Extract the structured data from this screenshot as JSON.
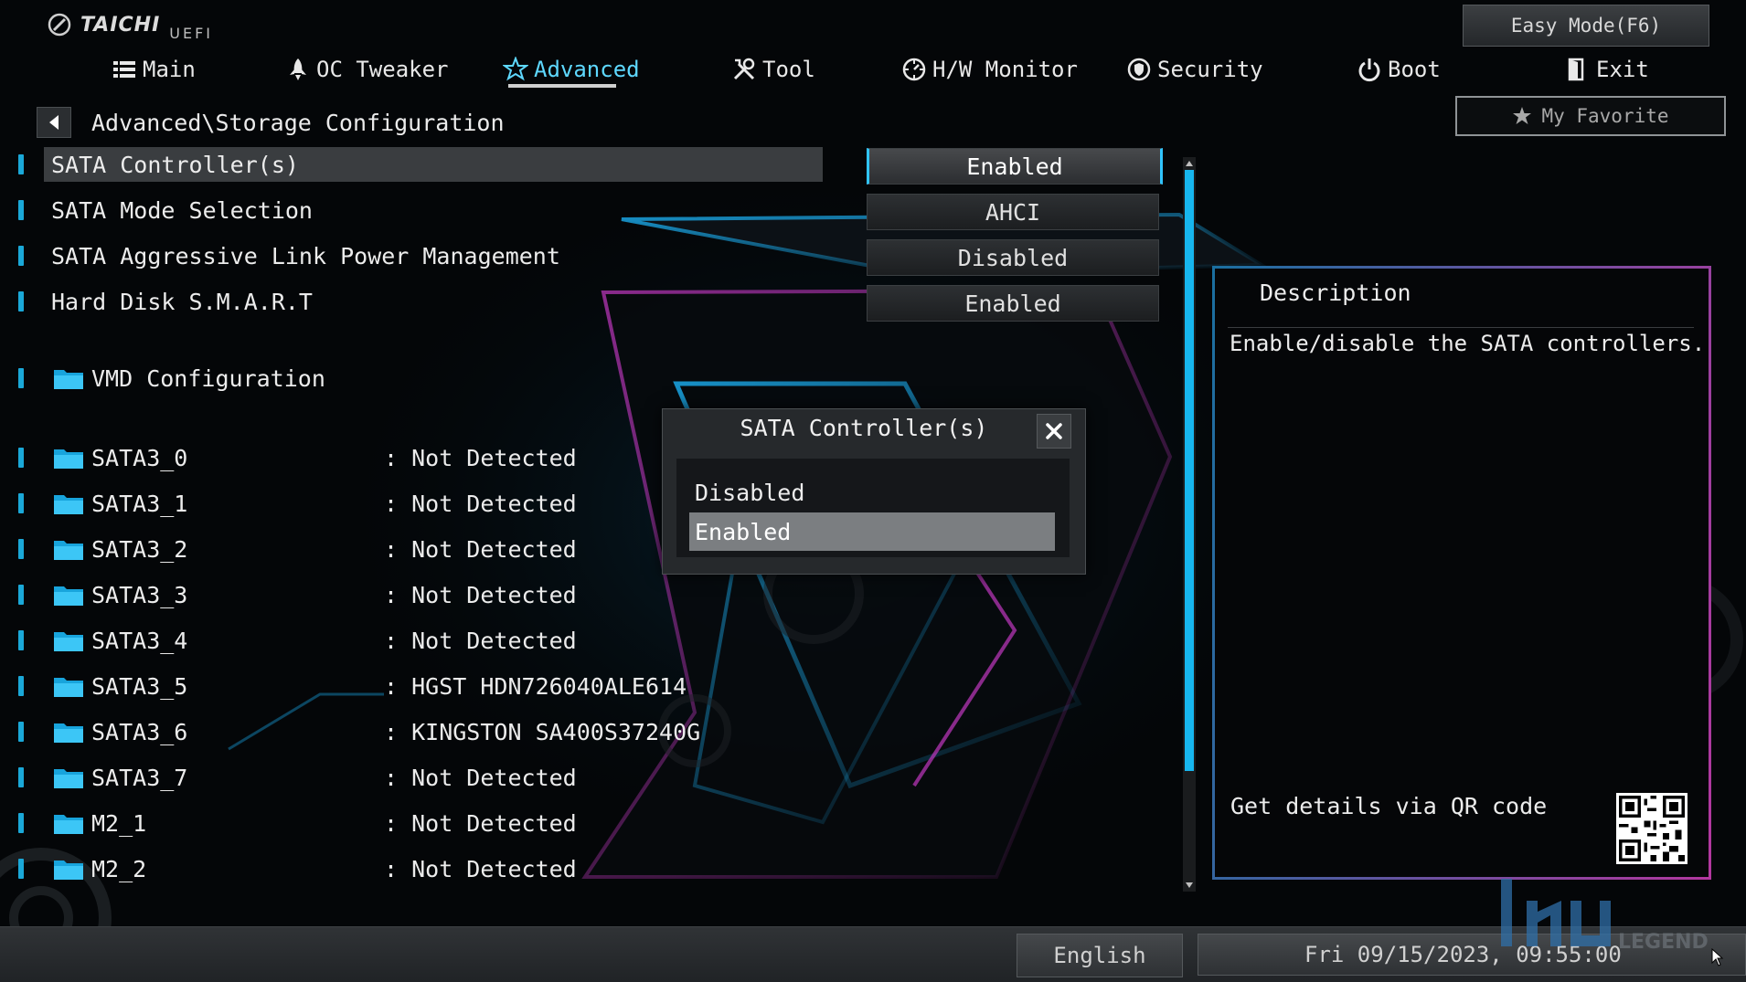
{
  "header": {
    "brand": "TAICHI",
    "brand_sub": "UEFI",
    "easy_mode": "Easy Mode(F6)",
    "my_favorite": "My Favorite"
  },
  "tabs": [
    {
      "label": "Main",
      "icon": "list-icon"
    },
    {
      "label": "OC Tweaker",
      "icon": "rocket-icon"
    },
    {
      "label": "Advanced",
      "icon": "star-icon",
      "active": true
    },
    {
      "label": "Tool",
      "icon": "tools-icon"
    },
    {
      "label": "H/W Monitor",
      "icon": "monitor-icon"
    },
    {
      "label": "Security",
      "icon": "shield-icon"
    },
    {
      "label": "Boot",
      "icon": "power-icon"
    },
    {
      "label": "Exit",
      "icon": "exit-icon"
    }
  ],
  "breadcrumb": "Advanced\\Storage Configuration",
  "settings": [
    {
      "label": "SATA Controller(s)",
      "value": "Enabled",
      "selected": true
    },
    {
      "label": "SATA Mode Selection",
      "value": "AHCI"
    },
    {
      "label": "SATA Aggressive Link Power Management",
      "value": "Disabled"
    },
    {
      "label": "Hard Disk S.M.A.R.T",
      "value": "Enabled"
    }
  ],
  "submenu": {
    "label": "VMD Configuration"
  },
  "ports": [
    {
      "name": "SATA3_0",
      "value": ": Not Detected"
    },
    {
      "name": "SATA3_1",
      "value": ": Not Detected"
    },
    {
      "name": "SATA3_2",
      "value": ": Not Detected"
    },
    {
      "name": "SATA3_3",
      "value": ": Not Detected"
    },
    {
      "name": "SATA3_4",
      "value": ": Not Detected"
    },
    {
      "name": "SATA3_5",
      "value": ": HGST HDN726040ALE614"
    },
    {
      "name": "SATA3_6",
      "value": ": KINGSTON SA400S37240G"
    },
    {
      "name": "SATA3_7",
      "value": ": Not Detected"
    },
    {
      "name": "M2_1",
      "value": ": Not Detected"
    },
    {
      "name": "M2_2",
      "value": ": Not Detected"
    }
  ],
  "description": {
    "title": "Description",
    "text": "Enable/disable the SATA controllers.",
    "qr_label": "Get details via QR code"
  },
  "modal": {
    "title": "SATA Controller(s)",
    "options": [
      "Disabled",
      "Enabled"
    ],
    "selected": "Enabled"
  },
  "footer": {
    "language": "English",
    "datetime": "Fri 09/15/2023, 09:55:00"
  },
  "colors": {
    "accent": "#17b6ee",
    "active_tab": "#5ed8ff",
    "panel_border_start": "#1a6fa0",
    "panel_border_end": "#b3379f"
  }
}
